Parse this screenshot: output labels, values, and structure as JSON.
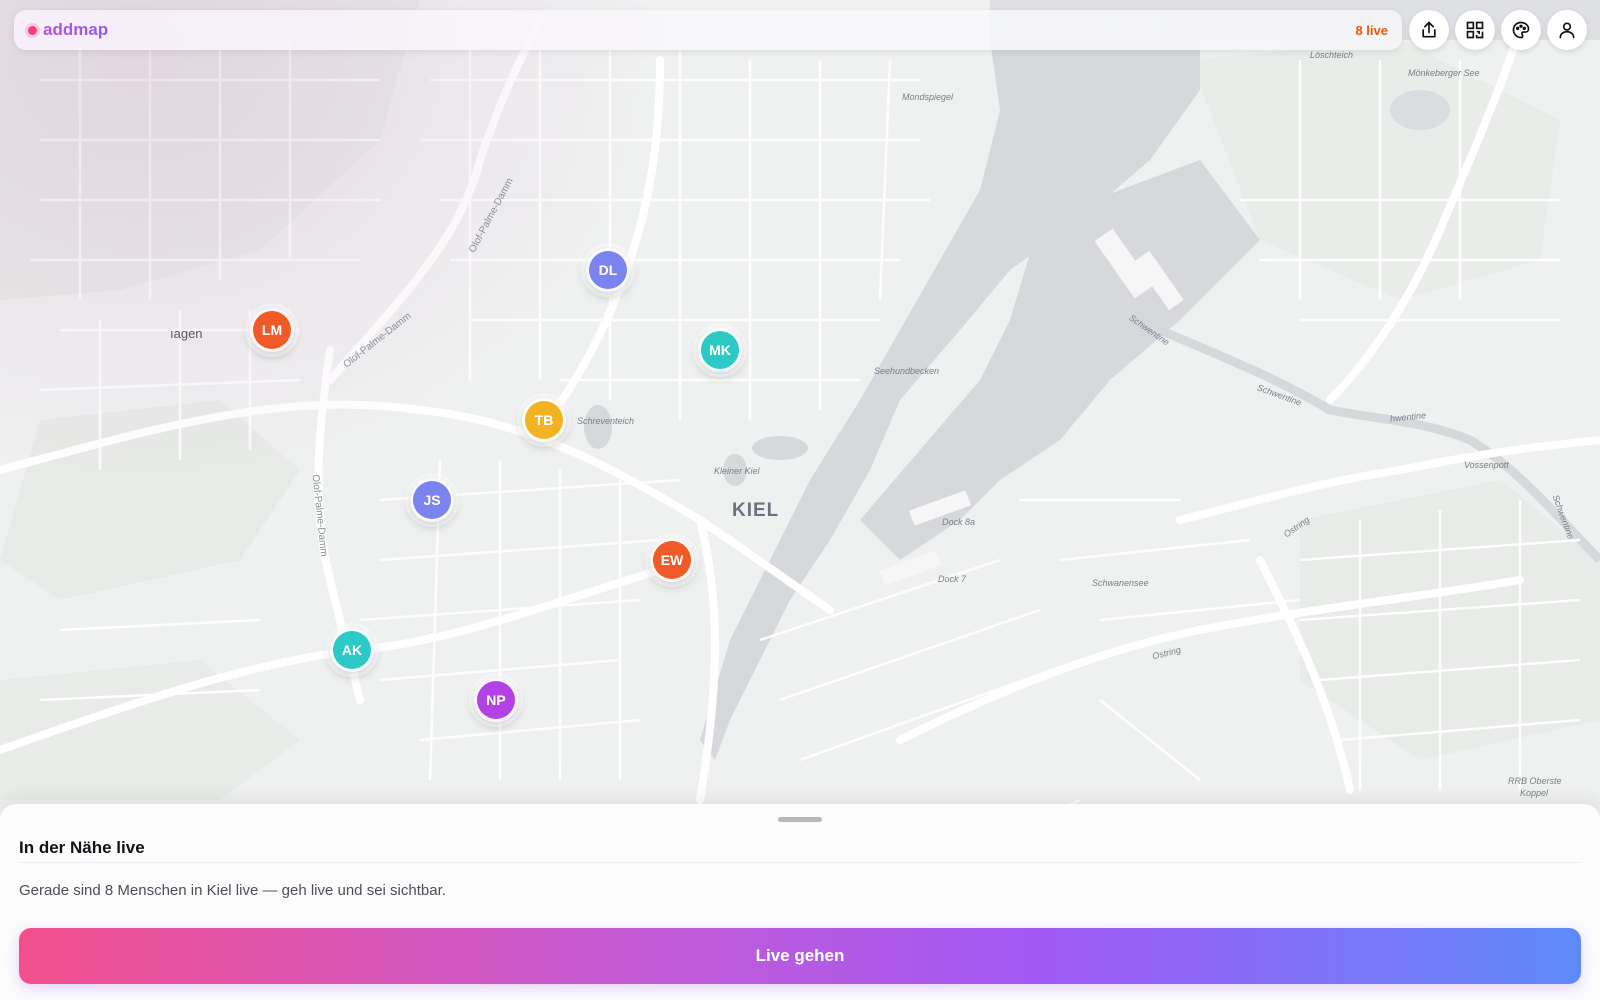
{
  "app": {
    "brand": "addmap",
    "live_count": "8 live"
  },
  "toolbar": {
    "icons": [
      "share-icon",
      "qr-code-icon",
      "palette-icon",
      "user-icon"
    ]
  },
  "map": {
    "city": "KIEL",
    "district": "ıagen",
    "labels": {
      "mondspiegel": "Mondspiegel",
      "seehundbecken": "Seehundbecken",
      "schreventeich": "Schreventeich",
      "kleiner_kiel": "Kleiner Kiel",
      "dock8a": "Dock 8a",
      "dock7": "Dock 7",
      "schwanensee": "Schwanensee",
      "ostring1": "Ostring",
      "ostring2": "Ostring",
      "vossenpott": "Vossenpott",
      "loeschteich": "Löschteich",
      "moenkeberger": "Mönkeberger See",
      "schwentine1": "Schwentine",
      "schwentine2": "Schwentine",
      "schwentine3": "hwentine",
      "schwentine4": "Schwentine",
      "rrb": "RRB Oberste",
      "koppel": "Koppel",
      "olof1": "Olof-Palme-Damm",
      "olof2": "Olof-Palme-Damm",
      "olof3": "Olof-Palme-Damm"
    },
    "markers": [
      {
        "initials": "DL",
        "color": "#7b83ee"
      },
      {
        "initials": "LM",
        "color": "#f05a28"
      },
      {
        "initials": "MK",
        "color": "#2cc9c7"
      },
      {
        "initials": "TB",
        "color": "#f3b221"
      },
      {
        "initials": "JS",
        "color": "#7b83ee"
      },
      {
        "initials": "EW",
        "color": "#f05a28"
      },
      {
        "initials": "AK",
        "color": "#2cc9c7"
      },
      {
        "initials": "NP",
        "color": "#b342e6"
      }
    ]
  },
  "sheet": {
    "title": "In der Nähe live",
    "text": "Gerade sind 8 Menschen in Kiel live — geh live und sei sichtbar.",
    "button": "Live gehen"
  },
  "colors": {
    "accent_pink": "#f2508d",
    "accent_purple": "#a259f4",
    "accent_blue": "#5e8af9",
    "water": "#d6d8dc",
    "live_orange": "#ea580c"
  }
}
